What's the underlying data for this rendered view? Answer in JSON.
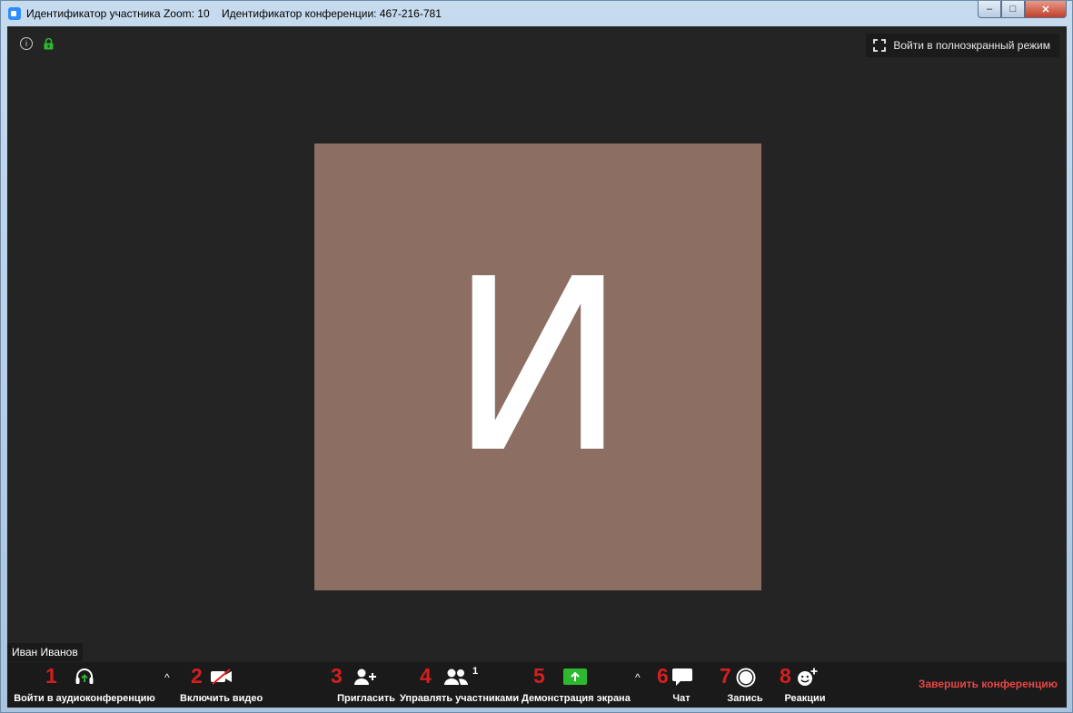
{
  "window": {
    "title_participant": "Идентификатор участника Zoom: 10",
    "title_meeting": "Идентификатор конференции: 467-216-781",
    "controls": {
      "minimize": "‒",
      "maximize": "□",
      "close": "✕"
    }
  },
  "top": {
    "info_icon_glyph": "i",
    "fullscreen_label": "Войти в полноэкранный режим"
  },
  "video": {
    "avatar_letter": "И",
    "avatar_color": "#8c6e62",
    "participant_name": "Иван Иванов"
  },
  "toolbar": {
    "markers": [
      "1",
      "2",
      "3",
      "4",
      "5",
      "6",
      "7",
      "8"
    ],
    "audio_label": "Войти в аудиоконференцию",
    "video_label": "Включить видео",
    "invite_label": "Пригласить",
    "participants_label": "Управлять участниками",
    "participants_count": "1",
    "share_label": "Демонстрация экрана",
    "chat_label": "Чат",
    "record_label": "Запись",
    "reactions_label": "Реакции",
    "end_label": "Завершить конференцию",
    "caret_glyph": "^",
    "accent_green": "#2db830",
    "end_color": "#e84646",
    "marker_color": "#d41f1f"
  }
}
